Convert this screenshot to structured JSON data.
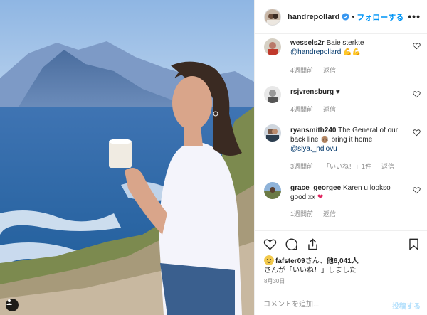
{
  "post": {
    "author": "handrepollard",
    "follow_label": "フォローする",
    "separator": "•",
    "more_label": "•••"
  },
  "comments": [
    {
      "username": "wessels2r",
      "text": "Baie sterkte",
      "mention": "@handrepollard",
      "emoji": "💪💪",
      "time": "4週間前",
      "reply_label": "返信"
    },
    {
      "username": "rsjvrensburg",
      "emoji": "♥",
      "time": "4週間前",
      "reply_label": "返信"
    },
    {
      "username": "ryansmith240",
      "text": "The General of our back line",
      "emoji": "👴🏽",
      "text2": "bring it home",
      "mention": "@siya._ndlovu",
      "time": "3週間前",
      "likes_label": "「いいね！」1件",
      "reply_label": "返信"
    },
    {
      "username": "grace_georgee",
      "text": "Karen u lookso good xx",
      "emoji": "❤",
      "time": "1週間前",
      "reply_label": "返信"
    }
  ],
  "likes": {
    "user": "fafster09",
    "suffix1": "さん、",
    "others": "他6,041人",
    "suffix2": "さんが「いいね！」しました"
  },
  "date": "8月30日",
  "comment_box": {
    "placeholder": "コメントを追加...",
    "post_label": "投稿する"
  },
  "colors": {
    "accent": "#0095f6",
    "post_disabled": "#b2dffc",
    "mention": "#00376b",
    "meta_gray": "#8e8e8e",
    "border": "#efefef"
  },
  "icons": [
    "verified-badge-icon",
    "heart-icon",
    "comment-icon",
    "share-icon",
    "bookmark-icon",
    "user-tag-icon"
  ]
}
